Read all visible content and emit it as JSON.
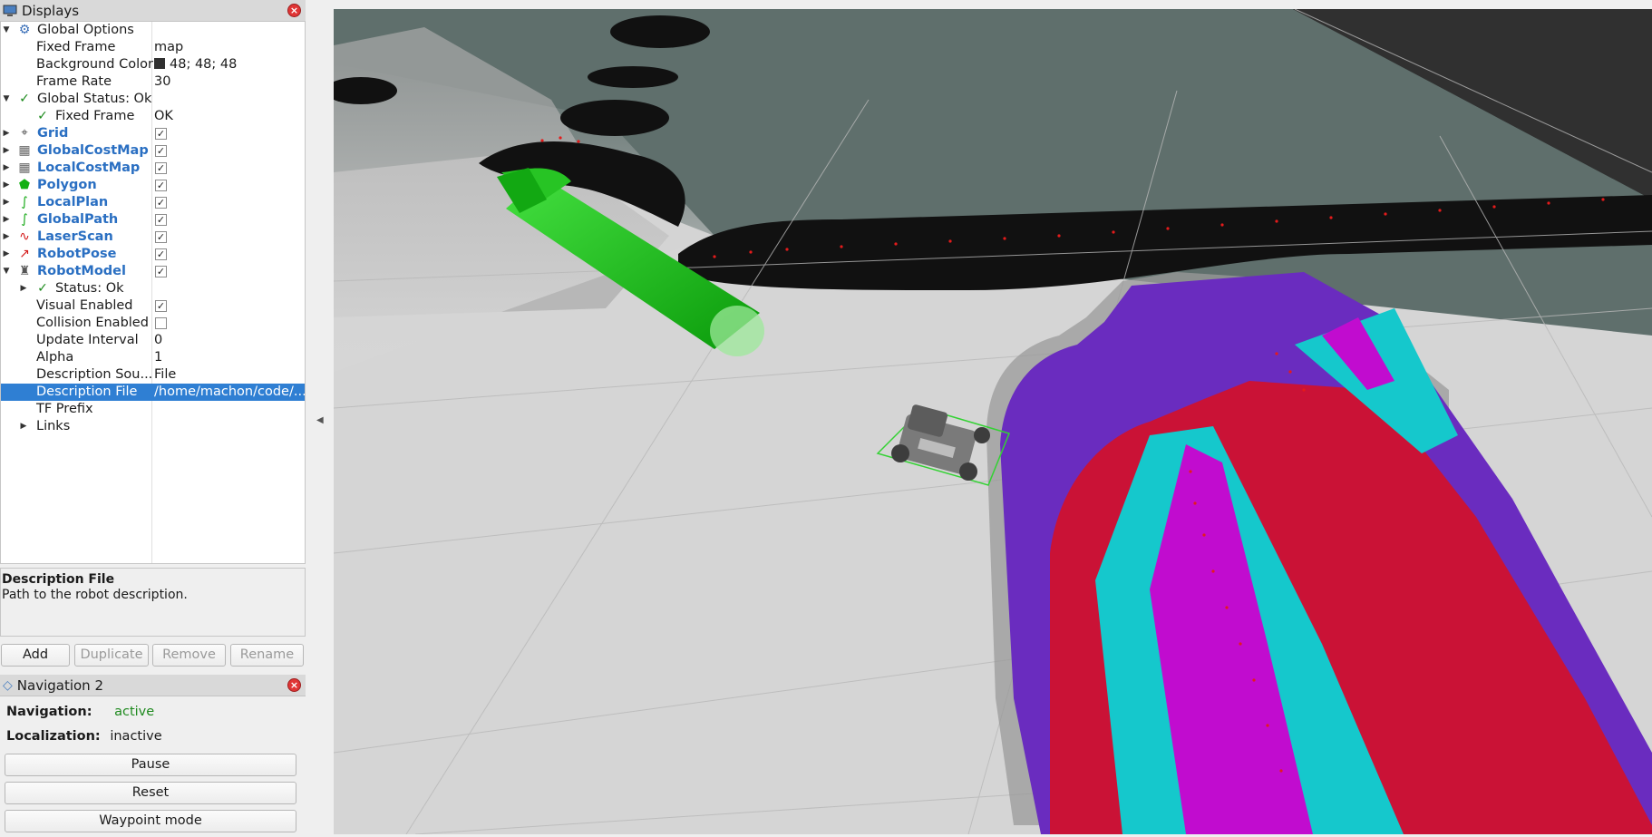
{
  "displays_panel": {
    "title": "Displays",
    "close_glyph": "×",
    "tree": [
      {
        "label": "Global Options",
        "icon": "gear-icon",
        "expanded": true,
        "value": ""
      },
      {
        "label": "Fixed Frame",
        "value": "map"
      },
      {
        "label": "Background Color",
        "value": "48; 48; 48",
        "color": "#303030"
      },
      {
        "label": "Frame Rate",
        "value": "30"
      },
      {
        "label": "Global Status: Ok",
        "icon": "check-icon",
        "expanded": true
      },
      {
        "label": "Fixed Frame",
        "icon": "check-icon",
        "value": "OK"
      },
      {
        "label": "Grid",
        "icon": "grid-icon",
        "checked": true
      },
      {
        "label": "GlobalCostMap",
        "icon": "map-icon",
        "checked": true
      },
      {
        "label": "LocalCostMap",
        "icon": "map-icon",
        "checked": true
      },
      {
        "label": "Polygon",
        "icon": "polygon-icon",
        "checked": true
      },
      {
        "label": "LocalPlan",
        "icon": "path-icon",
        "checked": true
      },
      {
        "label": "GlobalPath",
        "icon": "path-icon",
        "checked": true
      },
      {
        "label": "LaserScan",
        "icon": "laser-icon",
        "checked": true
      },
      {
        "label": "RobotPose",
        "icon": "pose-icon",
        "checked": true
      },
      {
        "label": "RobotModel",
        "icon": "robot-icon",
        "checked": true,
        "expanded": true
      },
      {
        "label": "Status: Ok",
        "icon": "check-icon"
      },
      {
        "label": "Visual Enabled",
        "checked": true
      },
      {
        "label": "Collision Enabled",
        "checked": false
      },
      {
        "label": "Update Interval",
        "value": "0"
      },
      {
        "label": "Alpha",
        "value": "1"
      },
      {
        "label": "Description Sou...",
        "value": "File"
      },
      {
        "label": "Description File",
        "value": "/home/machon/code/...",
        "selected": true
      },
      {
        "label": "TF Prefix",
        "value": ""
      },
      {
        "label": "Links"
      }
    ],
    "description": {
      "title": "Description File",
      "body": "Path to the robot description."
    },
    "buttons": {
      "add": "Add",
      "duplicate": "Duplicate",
      "remove": "Remove",
      "rename": "Rename"
    }
  },
  "navigation_panel": {
    "title": "Navigation 2",
    "navigation_label": "Navigation:",
    "navigation_value": "active",
    "navigation_color": "#1f8a1f",
    "localization_label": "Localization:",
    "localization_value": "inactive",
    "pause": "Pause",
    "reset": "Reset",
    "waypoint": "Waypoint mode"
  },
  "colors": {
    "background": "#303030",
    "map_free": "#d4d4d4",
    "map_unknown": "#5f6f6c",
    "map_occupied": "#111111",
    "costmap_purple": "#6a2cbf",
    "costmap_red": "#d2102a",
    "costmap_cyan": "#15c8cc",
    "costmap_magenta": "#c10ccf",
    "goal_arrow": "#18b816",
    "accent_blue": "#2a6fc2",
    "selection": "#2f7fd3"
  }
}
